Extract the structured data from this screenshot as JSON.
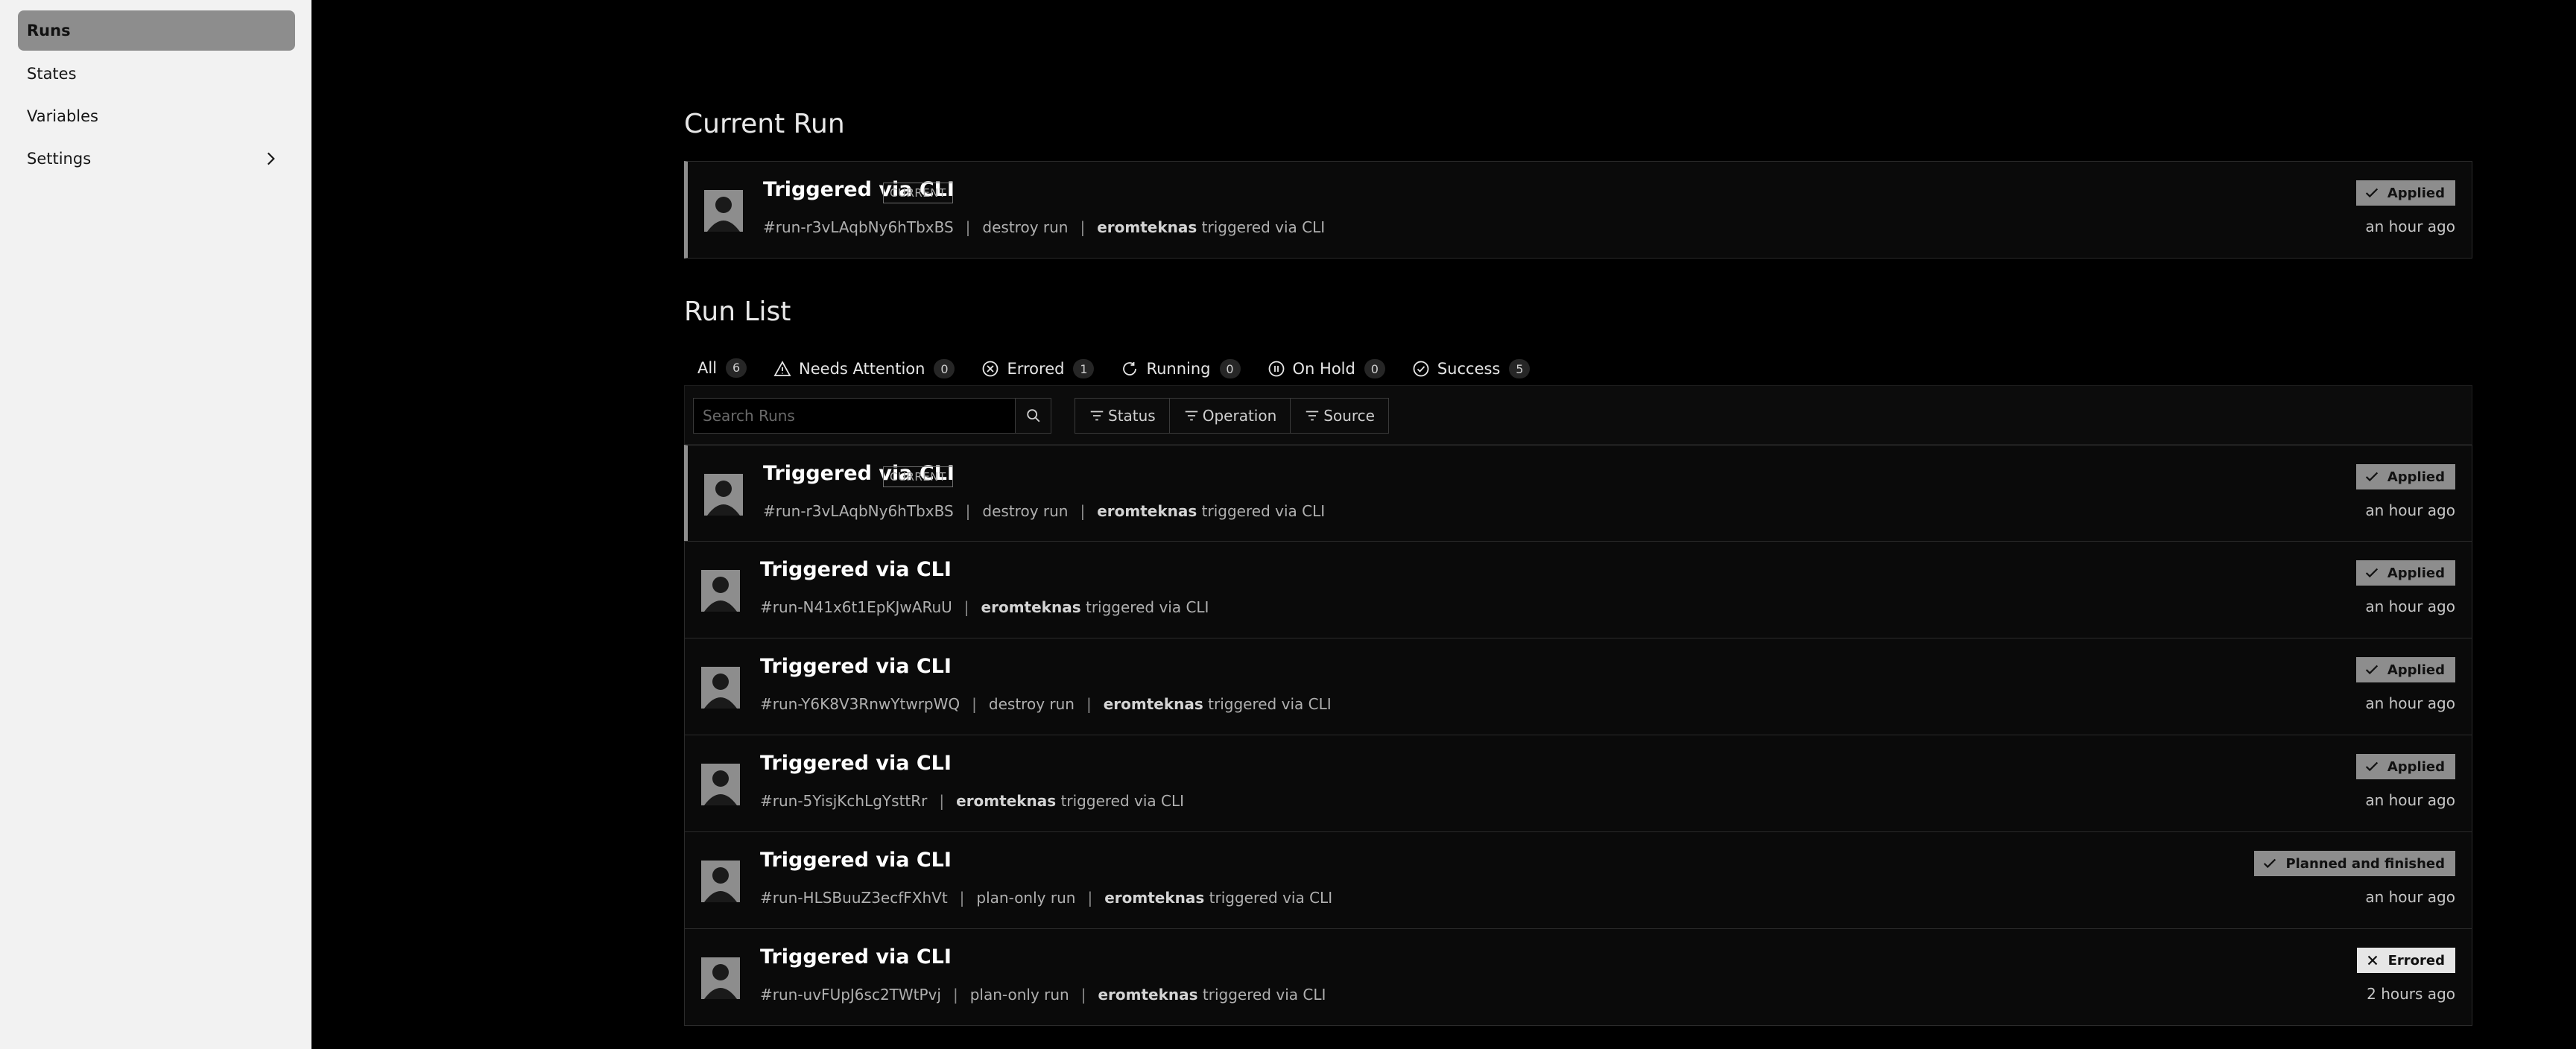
{
  "sidebar": {
    "items": [
      {
        "label": "Runs"
      },
      {
        "label": "States"
      },
      {
        "label": "Variables"
      },
      {
        "label": "Settings"
      }
    ]
  },
  "current_run": {
    "heading": "Current Run",
    "title": "Triggered via CLI",
    "tag": "CURRENT",
    "id": "#run-r3vLAqbNy6hTbxBS",
    "operation": "destroy run",
    "user": "eromteknas",
    "trigger": "triggered via CLI",
    "status": "Applied",
    "time": "an hour ago"
  },
  "run_list": {
    "heading": "Run List",
    "tabs": [
      {
        "label": "All",
        "count": "6",
        "icon": "none"
      },
      {
        "label": "Needs Attention",
        "count": "0",
        "icon": "warning-icon"
      },
      {
        "label": "Errored",
        "count": "1",
        "icon": "error-circle-icon"
      },
      {
        "label": "Running",
        "count": "0",
        "icon": "running-icon"
      },
      {
        "label": "On Hold",
        "count": "0",
        "icon": "pause-circle-icon"
      },
      {
        "label": "Success",
        "count": "5",
        "icon": "check-circle-icon"
      }
    ],
    "search_placeholder": "Search Runs",
    "filters": [
      {
        "label": "Status"
      },
      {
        "label": "Operation"
      },
      {
        "label": "Source"
      }
    ],
    "rows": [
      {
        "title": "Triggered via CLI",
        "tag": "CURRENT",
        "id": "#run-r3vLAqbNy6hTbxBS",
        "operation": "destroy run",
        "user": "eromteknas",
        "trigger": "triggered via CLI",
        "status": "Applied",
        "status_icon": "check-icon",
        "time": "an hour ago"
      },
      {
        "title": "Triggered via CLI",
        "tag": "",
        "id": "#run-N41x6t1EpKJwARuU",
        "operation": "",
        "user": "eromteknas",
        "trigger": "triggered via CLI",
        "status": "Applied",
        "status_icon": "check-icon",
        "time": "an hour ago"
      },
      {
        "title": "Triggered via CLI",
        "tag": "",
        "id": "#run-Y6K8V3RnwYtwrpWQ",
        "operation": "destroy run",
        "user": "eromteknas",
        "trigger": "triggered via CLI",
        "status": "Applied",
        "status_icon": "check-icon",
        "time": "an hour ago"
      },
      {
        "title": "Triggered via CLI",
        "tag": "",
        "id": "#run-5YisjKchLgYsttRr",
        "operation": "",
        "user": "eromteknas",
        "trigger": "triggered via CLI",
        "status": "Applied",
        "status_icon": "check-icon",
        "time": "an hour ago"
      },
      {
        "title": "Triggered via CLI",
        "tag": "",
        "id": "#run-HLSBuuZ3ecfFXhVt",
        "operation": "plan-only run",
        "user": "eromteknas",
        "trigger": "triggered via CLI",
        "status": "Planned and finished",
        "status_icon": "check-icon",
        "time": "an hour ago"
      },
      {
        "title": "Triggered via CLI",
        "tag": "",
        "id": "#run-uvFUpJ6sc2TWtPvj",
        "operation": "plan-only run",
        "user": "eromteknas",
        "trigger": "triggered via CLI",
        "status": "Errored",
        "status_icon": "close-icon",
        "time": "2 hours ago"
      }
    ]
  }
}
